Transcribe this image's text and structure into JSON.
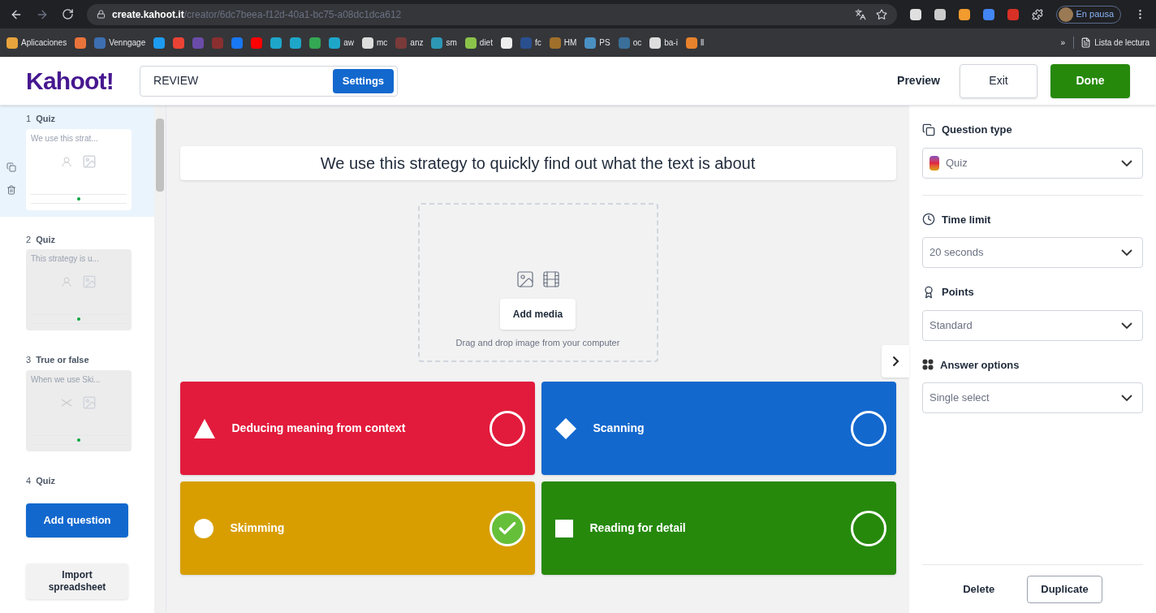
{
  "browser": {
    "url_host": "create.kahoot.it",
    "url_path": "/creator/6dc7beea-f12d-40a1-bc75-a08dc1dca612",
    "profile": "En pausa",
    "bookmarks": [
      {
        "label": "Aplicaciones",
        "color": "#e8a33c"
      },
      {
        "color": "#e9743b"
      },
      {
        "label": "Venngage",
        "color": "#3d6fb0"
      },
      {
        "color": "#1d9bf0"
      },
      {
        "color": "#ea4335"
      },
      {
        "color": "#6a4ca8"
      },
      {
        "color": "#8a2f2f"
      },
      {
        "color": "#1877f2"
      },
      {
        "color": "#ff0000"
      },
      {
        "color": "#1ea6c9"
      },
      {
        "color": "#1ea6c9"
      },
      {
        "color": "#34a853"
      },
      {
        "label": "aw",
        "color": "#1ea6c9"
      },
      {
        "label": "mc",
        "color": "#dddddd"
      },
      {
        "label": "anz",
        "color": "#7a3a3a"
      },
      {
        "label": "sm",
        "color": "#2c98b5"
      },
      {
        "label": "diet",
        "color": "#8bc34a"
      },
      {
        "color": "#eeeeee"
      },
      {
        "label": "fc",
        "color": "#2a4f8f"
      },
      {
        "label": "HM",
        "color": "#a0702a"
      },
      {
        "label": "PS",
        "color": "#4a90c2"
      },
      {
        "label": "oc",
        "color": "#3a6f9a"
      },
      {
        "label": "ba-i",
        "color": "#dddddd"
      },
      {
        "label": "ll",
        "color": "#e8822c"
      }
    ],
    "more": "»",
    "reading_list": "Lista de lectura"
  },
  "header": {
    "logo": "Kahoot!",
    "title": "REVIEW",
    "settings": "Settings",
    "preview": "Preview",
    "exit": "Exit",
    "done": "Done"
  },
  "questions": [
    {
      "number": "1",
      "type": "Quiz",
      "preview": "We use this strat...",
      "selected": true,
      "kind": "quiz"
    },
    {
      "number": "2",
      "type": "Quiz",
      "preview": "This strategy is u...",
      "selected": false,
      "kind": "quiz"
    },
    {
      "number": "3",
      "type": "True or false",
      "preview": "When we use Ski...",
      "selected": false,
      "kind": "truefalse"
    },
    {
      "number": "4",
      "type": "Quiz",
      "selected": false,
      "kind": "collapsed"
    }
  ],
  "add_question": "Add question",
  "import": "Import spreadsheet",
  "question": {
    "text": "We use this strategy to quickly find out what the text is about",
    "add_media": "Add media",
    "media_hint": "Drag and drop image from your computer"
  },
  "answers": [
    {
      "text": "Deducing meaning from context",
      "kind": "triangle",
      "color": "#e21b3c",
      "correct": false
    },
    {
      "text": "Scanning",
      "kind": "diamond",
      "color": "#1368ce",
      "correct": false
    },
    {
      "text": "Skimming",
      "kind": "circle",
      "color": "#d89e00",
      "correct": true
    },
    {
      "text": "Reading for detail",
      "kind": "square",
      "color": "#26890c",
      "correct": false
    }
  ],
  "settings": [
    {
      "label": "Question type",
      "kind": "type",
      "value": "Quiz"
    },
    {
      "label": "Time limit",
      "kind": "clock",
      "value": "20 seconds"
    },
    {
      "label": "Points",
      "kind": "medal",
      "value": "Standard"
    },
    {
      "label": "Answer options",
      "kind": "grid",
      "value": "Single select"
    }
  ],
  "delete": "Delete",
  "duplicate": "Duplicate"
}
